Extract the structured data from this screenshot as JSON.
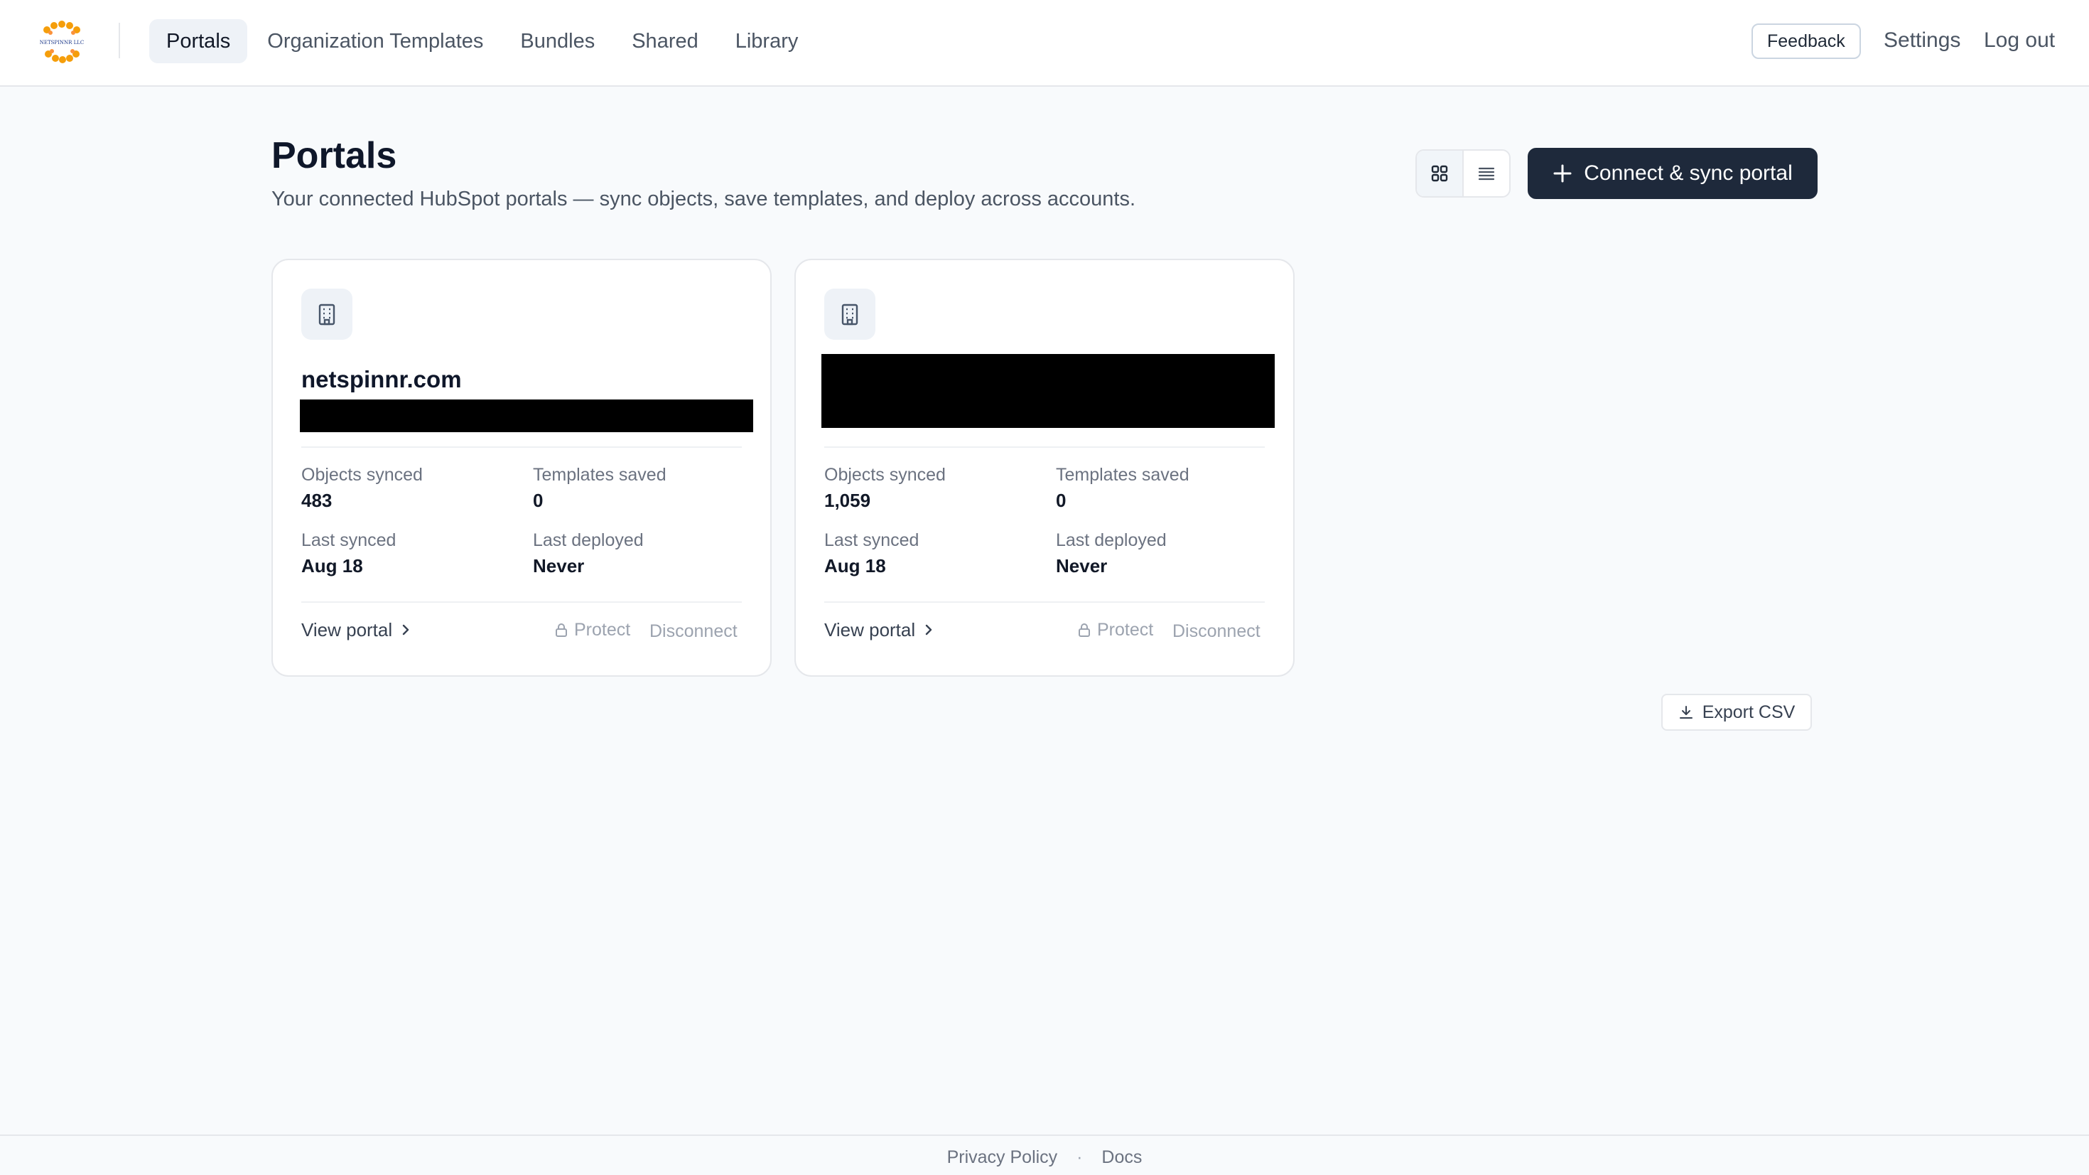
{
  "nav": {
    "logo_text": "NETSPINNR LLC",
    "items": [
      {
        "label": "Portals",
        "active": true
      },
      {
        "label": "Organization Templates",
        "active": false
      },
      {
        "label": "Bundles",
        "active": false
      },
      {
        "label": "Shared",
        "active": false
      },
      {
        "label": "Library",
        "active": false
      }
    ],
    "feedback_label": "Feedback",
    "settings_label": "Settings",
    "logout_label": "Log out"
  },
  "header": {
    "title": "Portals",
    "subtitle": "Your connected HubSpot portals — sync objects, save templates, and deploy across accounts.",
    "connect_label": "Connect & sync portal",
    "view_mode": "grid"
  },
  "cards": [
    {
      "name": "netspinnr.com",
      "objects_label": "Objects synced",
      "objects": "483",
      "templates_label": "Templates saved",
      "templates": "0",
      "last_synced_label": "Last synced",
      "last_synced": "Aug 18",
      "last_deployed_label": "Last deployed",
      "last_deployed": "Never",
      "view_label": "View portal",
      "protect_label": "Protect",
      "disconnect_label": "Disconnect"
    },
    {
      "name": "",
      "objects_label": "Objects synced",
      "objects": "1,059",
      "templates_label": "Templates saved",
      "templates": "0",
      "last_synced_label": "Last synced",
      "last_synced": "Aug 18",
      "last_deployed_label": "Last deployed",
      "last_deployed": "Never",
      "view_label": "View portal",
      "protect_label": "Protect",
      "disconnect_label": "Disconnect"
    }
  ],
  "export_label": "Export CSV",
  "footer": {
    "privacy": "Privacy Policy",
    "separator": "·",
    "docs": "Docs"
  }
}
